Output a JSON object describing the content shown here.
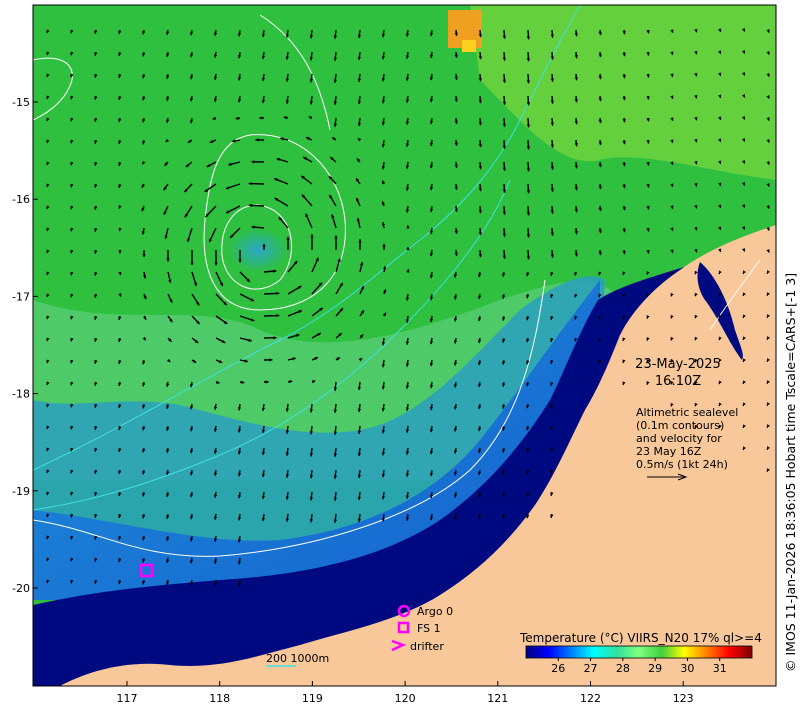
{
  "map": {
    "x_ticks": [
      {
        "value": 117,
        "label": "117"
      },
      {
        "value": 118,
        "label": "118"
      },
      {
        "value": 119,
        "label": "119"
      },
      {
        "value": 120,
        "label": "120"
      },
      {
        "value": 121,
        "label": "121"
      },
      {
        "value": 122,
        "label": "122"
      },
      {
        "value": 123,
        "label": "123"
      }
    ],
    "y_ticks": [
      {
        "value": -15,
        "label": "-15"
      },
      {
        "value": -16,
        "label": "-16"
      },
      {
        "value": -17,
        "label": "-17"
      },
      {
        "value": -18,
        "label": "-18"
      },
      {
        "value": -19,
        "label": "-19"
      },
      {
        "value": -20,
        "label": "-20"
      }
    ],
    "lon_range": [
      116.0,
      124.0
    ],
    "lat_range": [
      -21.0,
      -14.0
    ]
  },
  "annotations": {
    "date": "23-May-2025",
    "time": "16:10Z",
    "sealevel_lines": [
      "Altimetric sealevel",
      "(0.1m contours)",
      "and velocity for",
      "23 May 16Z",
      "0.5m/s (1kt 24h)"
    ]
  },
  "legend": {
    "argo_label": "Argo 0",
    "fs_label": "FS 1",
    "drifter_label": "drifter",
    "marker_color": "#ff00ff"
  },
  "scale_bar": {
    "label": "200  1000m"
  },
  "colorbar": {
    "title": "Temperature (°C) VIIRS_N20 17% ql>=4",
    "min": 25,
    "max": 32,
    "tick_labels": [
      "26",
      "27",
      "28",
      "29",
      "30",
      "31"
    ],
    "colors": [
      "#00007f",
      "#0000ff",
      "#007fff",
      "#00ffff",
      "#2fe0a0",
      "#7fff7f",
      "#3fcf3f",
      "#ffff00",
      "#ff7f00",
      "#ff0000",
      "#7f0000"
    ]
  },
  "credit": "© IMOS 11-Jan-2026 18:36:05 Hobart time Tscale=CARS+[-1 3]",
  "colors": {
    "land": "#f8c89a",
    "cold_water": "#000a80",
    "warm_water": "#2fc040"
  }
}
